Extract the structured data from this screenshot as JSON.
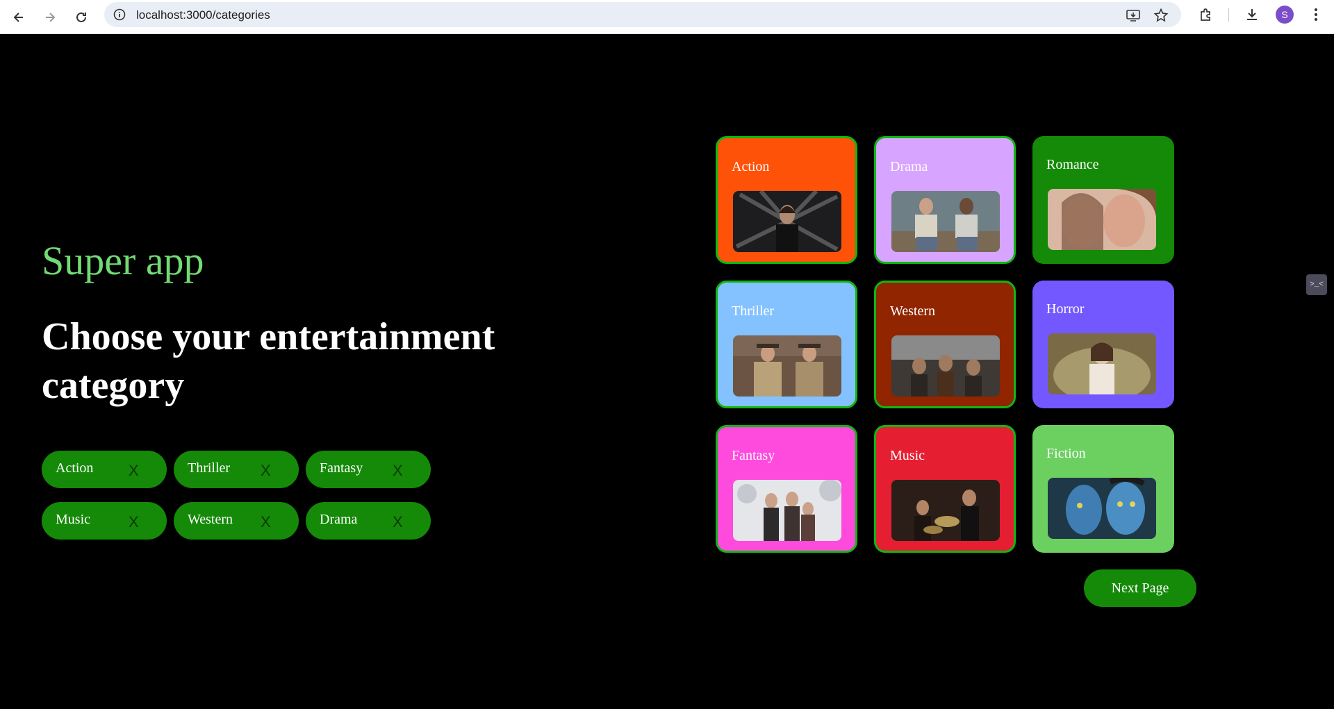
{
  "browser": {
    "url": "localhost:3000/categories",
    "avatar_letter": "S",
    "icons": [
      "back-arrow-icon",
      "forward-arrow-icon",
      "reload-icon",
      "site-info-icon",
      "install-app-icon",
      "bookmark-star-icon",
      "extensions-icon",
      "download-icon",
      "kebab-menu-icon"
    ]
  },
  "page": {
    "brand": "Super app",
    "heading": "Choose your entertainment category",
    "selected_chips": [
      {
        "label": "Action",
        "remove": "X"
      },
      {
        "label": "Thriller",
        "remove": "X"
      },
      {
        "label": "Fantasy",
        "remove": "X"
      },
      {
        "label": "Music",
        "remove": "X"
      },
      {
        "label": "Western",
        "remove": "X"
      },
      {
        "label": "Drama",
        "remove": "X"
      }
    ],
    "categories": [
      {
        "title": "Action",
        "color": "#ff5209",
        "selected": true
      },
      {
        "title": "Drama",
        "color": "#d7a4ff",
        "selected": true
      },
      {
        "title": "Romance",
        "color": "#148a08",
        "selected": false
      },
      {
        "title": "Thriller",
        "color": "#84c2ff",
        "selected": true
      },
      {
        "title": "Western",
        "color": "#902500",
        "selected": true
      },
      {
        "title": "Horror",
        "color": "#7358ff",
        "selected": false
      },
      {
        "title": "Fantasy",
        "color": "#ff4ade",
        "selected": true
      },
      {
        "title": "Music",
        "color": "#e61e32",
        "selected": true
      },
      {
        "title": "Fiction",
        "color": "#6cd061",
        "selected": false
      }
    ],
    "next_label": "Next Page",
    "side_tab_label": ">_<"
  },
  "colors": {
    "brand_green": "#72db73",
    "chip_green": "#148a08",
    "selected_border": "#11b711"
  }
}
